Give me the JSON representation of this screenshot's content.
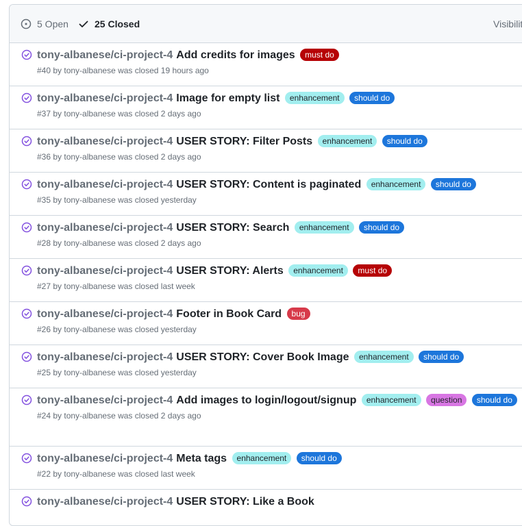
{
  "header": {
    "open_label": "5 Open",
    "closed_label": "25 Closed",
    "visibility_label": "Visibility"
  },
  "colors": {
    "closed_purple": "#8250df",
    "label_must_do": "#b60205",
    "label_should_do": "#1d76db",
    "label_enhancement": "#a2eeef",
    "label_bug": "#d73a4a",
    "label_question": "#d876e3"
  },
  "issues": [
    {
      "repo": "tony-albanese/ci-project-4",
      "title": "Add credits for images",
      "labels": [
        "must do"
      ],
      "meta": "#40 by tony-albanese was closed 19 hours ago"
    },
    {
      "repo": "tony-albanese/ci-project-4",
      "title": "Image for empty list",
      "labels": [
        "enhancement",
        "should do"
      ],
      "meta": "#37 by tony-albanese was closed 2 days ago"
    },
    {
      "repo": "tony-albanese/ci-project-4",
      "title": "USER STORY: Filter Posts",
      "labels": [
        "enhancement",
        "should do"
      ],
      "meta": "#36 by tony-albanese was closed 2 days ago"
    },
    {
      "repo": "tony-albanese/ci-project-4",
      "title": "USER STORY: Content is paginated",
      "labels": [
        "enhancement",
        "should do"
      ],
      "meta": "#35 by tony-albanese was closed yesterday"
    },
    {
      "repo": "tony-albanese/ci-project-4",
      "title": "USER STORY: Search",
      "labels": [
        "enhancement",
        "should do"
      ],
      "meta": "#28 by tony-albanese was closed 2 days ago"
    },
    {
      "repo": "tony-albanese/ci-project-4",
      "title": "USER STORY: Alerts",
      "labels": [
        "enhancement",
        "must do"
      ],
      "meta": "#27 by tony-albanese was closed last week"
    },
    {
      "repo": "tony-albanese/ci-project-4",
      "title": "Footer in Book Card",
      "labels": [
        "bug"
      ],
      "meta": "#26 by tony-albanese was closed yesterday"
    },
    {
      "repo": "tony-albanese/ci-project-4",
      "title": "USER STORY: Cover Book Image",
      "labels": [
        "enhancement",
        "should do"
      ],
      "meta": "#25 by tony-albanese was closed yesterday"
    },
    {
      "repo": "tony-albanese/ci-project-4",
      "title": "Add images to login/logout/signup",
      "labels": [
        "enhancement",
        "question",
        "should do"
      ],
      "meta": "#24 by tony-albanese was closed 2 days ago"
    },
    {
      "repo": "tony-albanese/ci-project-4",
      "title": "Meta tags",
      "labels": [
        "enhancement",
        "should do"
      ],
      "meta": "#22 by tony-albanese was closed last week"
    },
    {
      "repo": "tony-albanese/ci-project-4",
      "title": "USER STORY: Like a Book",
      "labels": [],
      "meta": ""
    }
  ]
}
